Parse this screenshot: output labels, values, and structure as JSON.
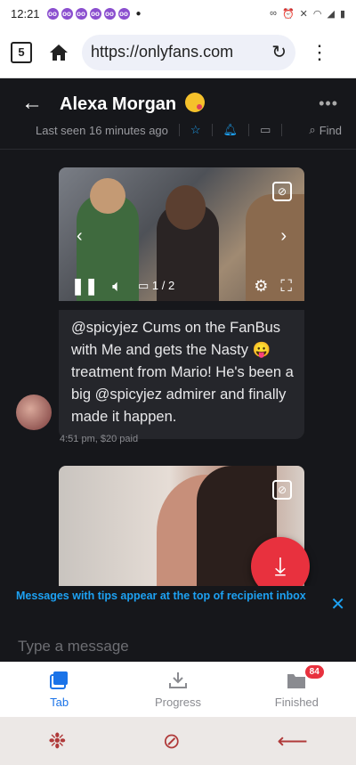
{
  "status_bar": {
    "time": "12:21",
    "notification_count": 6
  },
  "browser": {
    "tab_count": "5",
    "url": "https://onlyfans.com"
  },
  "chat": {
    "contact_name": "Alexa Morgan",
    "last_seen": "Last seen 16 minutes ago",
    "find_label": "Find"
  },
  "message": {
    "media_counter": "1 / 2",
    "text": "@spicyjez Cums on the FanBus with Me and gets the Nasty 😛 treatment from Mario! He's been a big @spicyjez admirer and finally made it happen.",
    "meta": "4:51 pm, $20 paid"
  },
  "tip_notice": "Messages with tips appear at the top of recipient inbox",
  "compose": {
    "placeholder": "Type a message"
  },
  "download_bar": {
    "tab_label": "Tab",
    "progress_label": "Progress",
    "finished_label": "Finished",
    "finished_badge": "84"
  },
  "colors": {
    "accent": "#1da1f2",
    "fab": "#e8313e",
    "chat_bg": "#16171b"
  }
}
